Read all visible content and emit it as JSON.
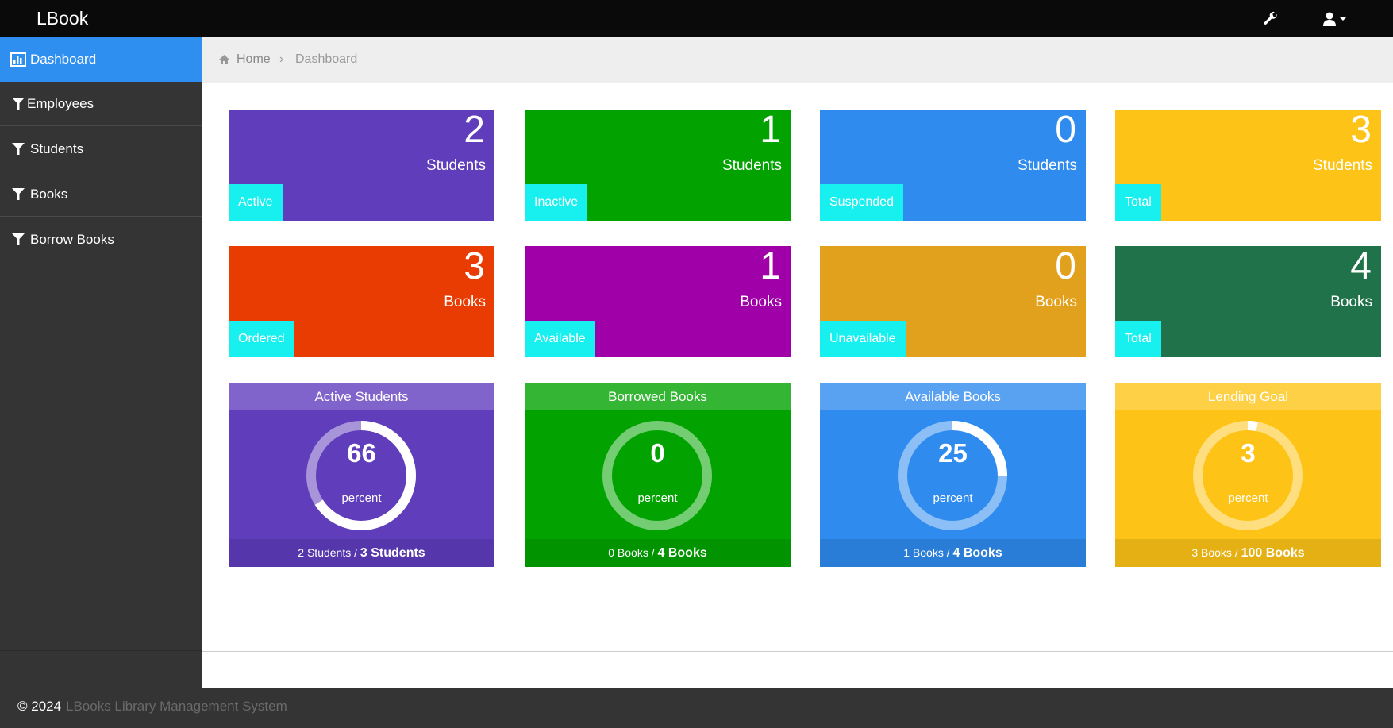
{
  "app": {
    "brand": "LBook"
  },
  "navbar": {
    "wrench_icon": "wrench-icon",
    "user_icon": "user-icon"
  },
  "sidebar": {
    "items": [
      {
        "label": "Dashboard",
        "icon": "bar-chart-icon",
        "active": true
      },
      {
        "label": "Employees",
        "icon": "filter-icon",
        "active": false
      },
      {
        "label": "Students",
        "icon": "filter-icon",
        "active": false
      },
      {
        "label": "Books",
        "icon": "filter-icon",
        "active": false
      },
      {
        "label": "Borrow Books",
        "icon": "filter-icon",
        "active": false
      }
    ]
  },
  "breadcrumb": {
    "home": "Home",
    "separator": "›",
    "current": "Dashboard"
  },
  "tiles": [
    {
      "value": "2",
      "unit": "Students",
      "tag": "Active",
      "color": "#5f3dbb"
    },
    {
      "value": "1",
      "unit": "Students",
      "tag": "Inactive",
      "color": "#02a300"
    },
    {
      "value": "0",
      "unit": "Students",
      "tag": "Suspended",
      "color": "#2f8bee"
    },
    {
      "value": "3",
      "unit": "Students",
      "tag": "Total",
      "color": "#fdc316"
    },
    {
      "value": "3",
      "unit": "Books",
      "tag": "Ordered",
      "color": "#e83c02"
    },
    {
      "value": "1",
      "unit": "Books",
      "tag": "Available",
      "color": "#a000a8"
    },
    {
      "value": "0",
      "unit": "Books",
      "tag": "Unavailable",
      "color": "#e2a11c"
    },
    {
      "value": "4",
      "unit": "Books",
      "tag": "Total",
      "color": "#20724a"
    }
  ],
  "panels": [
    {
      "title": "Active Students",
      "value": "66",
      "percent": 66,
      "unit": "percent",
      "footer_small": "2 Students /",
      "footer_bold": "3 Students",
      "color": "#5f3dbb",
      "head_color": "#8063cb",
      "foot_color": "#5536ab"
    },
    {
      "title": "Borrowed Books",
      "value": "0",
      "percent": 0,
      "unit": "percent",
      "footer_small": "0 Books /",
      "footer_bold": "4 Books",
      "color": "#02a300",
      "head_color": "#35b534",
      "foot_color": "#029300"
    },
    {
      "title": "Available Books",
      "value": "25",
      "percent": 25,
      "unit": "percent",
      "footer_small": "1 Books /",
      "footer_bold": "4 Books",
      "color": "#2f8bee",
      "head_color": "#59a2f1",
      "foot_color": "#2a7dd6"
    },
    {
      "title": "Lending Goal",
      "value": "3",
      "percent": 3,
      "unit": "percent",
      "footer_small": "3 Books /",
      "footer_bold": "100 Books",
      "color": "#fdc316",
      "head_color": "#fdd046",
      "foot_color": "#e4b014"
    }
  ],
  "footer": {
    "copyright": "© 2024",
    "system_name": "LBooks Library Management System"
  }
}
